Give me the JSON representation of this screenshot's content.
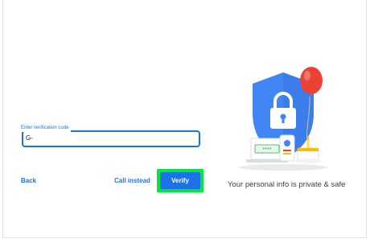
{
  "form": {
    "field_label": "Enter verification code",
    "field_value": "G-"
  },
  "actions": {
    "back_label": "Back",
    "call_label": "Call instead",
    "verify_label": "Verify"
  },
  "privacy": {
    "text": "Your personal info is private & safe",
    "password_mask": "****"
  },
  "colors": {
    "accent": "#1a73e8",
    "highlight": "#00e83a",
    "shield": "#4285f4",
    "balloon": "#ea4335"
  }
}
